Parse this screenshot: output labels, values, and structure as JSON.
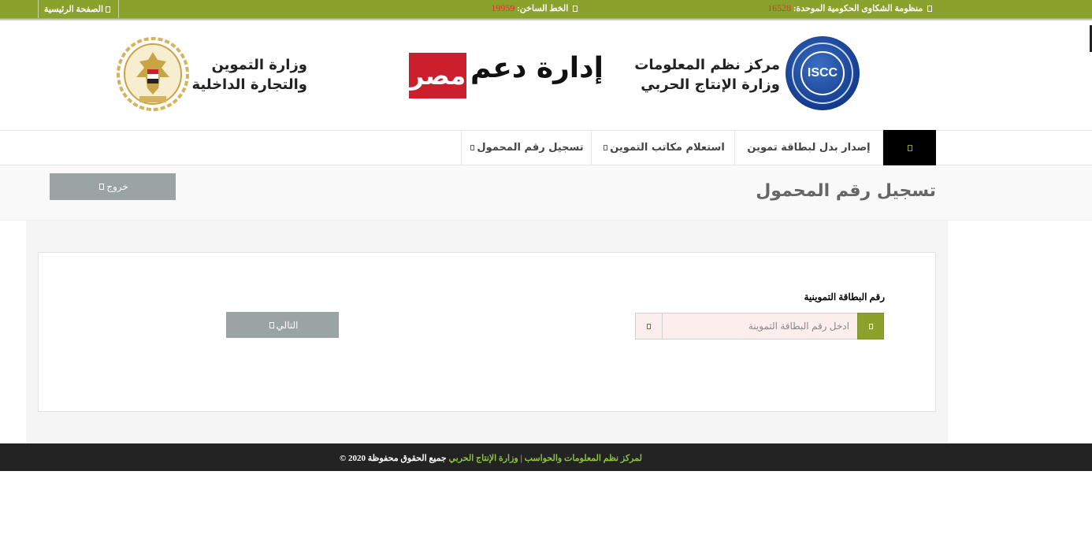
{
  "topbar": {
    "complaints_label": "منظومة الشكاوى الحكومية الموحدة:",
    "complaints_number": "16528",
    "hotline_label": "الخط الساخن:",
    "hotline_number": "19959",
    "home_label": "الصفحة الرئيسية"
  },
  "header": {
    "isc_logo_text": "ISCC",
    "isc_line1": "مركز نظم المعلومات",
    "isc_line2": "وزارة الإنتاج الحربي",
    "daam_idara": "إدارة دعم",
    "daam_misr": "مصر",
    "ministry_line1": "وزارة التموين",
    "ministry_line2": "والتجارة الداخلية"
  },
  "nav": {
    "items": [
      {
        "label": "إصدار بدل لبطاقة تموين"
      },
      {
        "label": "استعلام مكاتب التموين"
      },
      {
        "label": "تسجيل رقم المحمول"
      }
    ]
  },
  "page": {
    "title": "تسجيل رقم المحمول",
    "logout_label": "خروج"
  },
  "form": {
    "card_label": "رقم البطاقة التموينية",
    "card_placeholder": "ادخل رقم البطاقة التموينة",
    "card_value": "",
    "next_label": "التالي"
  },
  "footer": {
    "rights": "جميع الحقوق محفوظة",
    "owner": "لمركز نظم المعلومات والحواسب | وزارة الإنتاج الحربي",
    "year": "© 2020"
  },
  "colors": {
    "brand_green": "#8aa12c",
    "button_gray": "#9aa4a2",
    "footer_dark": "#232323",
    "accent_red": "#cc1f2d"
  }
}
